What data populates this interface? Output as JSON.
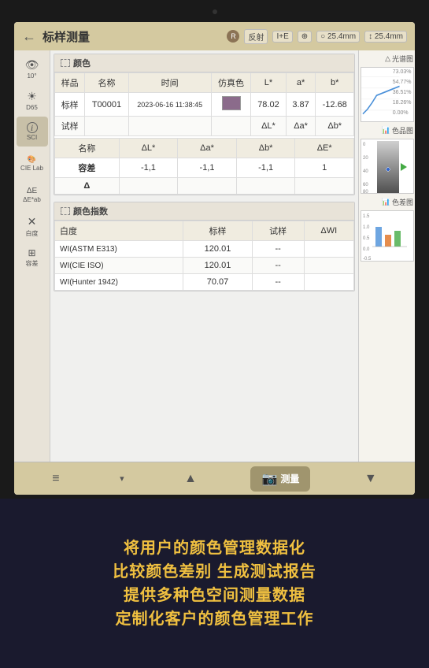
{
  "header": {
    "back_label": "←",
    "title": "标样测量",
    "badge_label": "R",
    "controls": [
      "反射",
      "I+E",
      "⊕",
      "25.4mm",
      "25.4mm"
    ]
  },
  "sidebar": {
    "items": [
      {
        "label": "10°",
        "icon": "👁",
        "id": "ten-degree"
      },
      {
        "label": "D65",
        "icon": "☀",
        "id": "d65"
      },
      {
        "label": "SCI",
        "icon": "ℹ",
        "id": "sci"
      },
      {
        "label": "CIE Lab",
        "icon": "🎨",
        "id": "cie-lab"
      },
      {
        "label": "ΔE*ab",
        "icon": "Δ",
        "id": "delta-e"
      },
      {
        "label": "白度",
        "icon": "✕",
        "id": "whiteness"
      },
      {
        "label": "容差",
        "icon": "⊞",
        "id": "tolerance"
      }
    ]
  },
  "color_section": {
    "title": "颜色",
    "table_headers": [
      "样品",
      "名称",
      "时间",
      "仿真色",
      "L*",
      "a*",
      "b*"
    ],
    "sample_row": {
      "type": "标样",
      "name": "T00001",
      "time": "2023-06-16 11:38:45",
      "L": "78.02",
      "a": "3.87",
      "b": "-12.68"
    },
    "trial_headers": [
      "试样",
      "",
      "",
      "",
      "ΔL*",
      "Δa*",
      "Δb*"
    ],
    "diff_section": {
      "headers": [
        "名称",
        "ΔL*",
        "Δa*",
        "Δb*",
        "ΔE*"
      ],
      "rows": [
        {
          "name": "容差",
          "dl": "-1,1",
          "da": "-1,1",
          "db": "-1,1",
          "de": "1"
        },
        {
          "name": "Δ",
          "dl": "",
          "da": "",
          "db": "",
          "de": ""
        }
      ]
    }
  },
  "color_index_section": {
    "title": "颜色指数",
    "table_headers": [
      "白度",
      "标样",
      "试样",
      "ΔWI"
    ],
    "rows": [
      {
        "name": "WI(ASTM E313)",
        "standard": "120.01",
        "trial": "--",
        "delta": ""
      },
      {
        "name": "WI(CIE ISO)",
        "standard": "120.01",
        "trial": "--",
        "delta": ""
      },
      {
        "name": "WI(Hunter 1942)",
        "standard": "70.07",
        "trial": "--",
        "delta": ""
      }
    ]
  },
  "right_panel": {
    "spectrum_label": "光谱图",
    "color_label": "色品图",
    "bar_label": "色差图",
    "spectrum_y_values": [
      "73.03%",
      "54.77%",
      "36.51%",
      "18.26%",
      "0.00%"
    ]
  },
  "toolbar": {
    "menu_label": "≡",
    "up_label": "▲",
    "measure_label": "测量",
    "down_label": "▼"
  },
  "bottom_text": {
    "lines": [
      "将用户的颜色管理数据化",
      "比较颜色差别 生成测试报告",
      "提供多种色空间测量数据",
      "定制化客户的颜色管理工作"
    ]
  }
}
